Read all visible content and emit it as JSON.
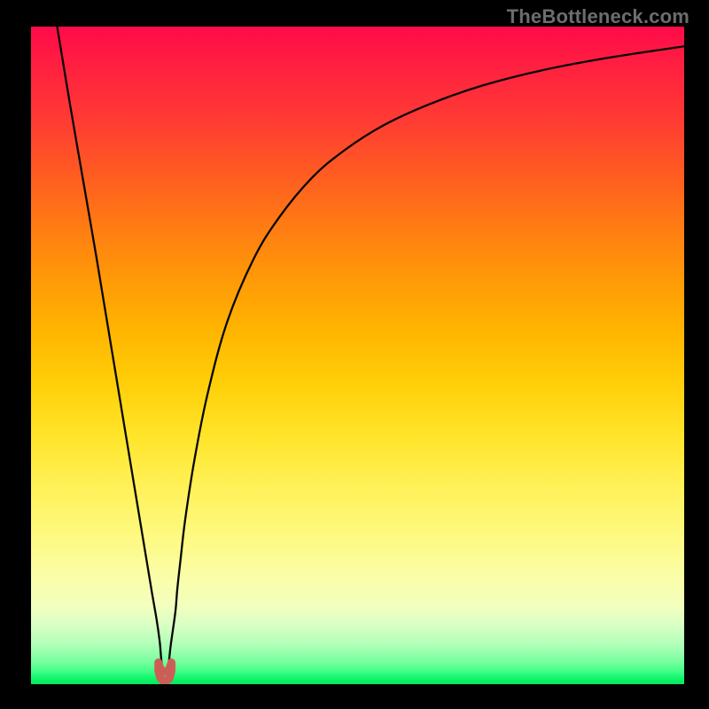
{
  "attribution": "TheBottleneck.com",
  "chart_data": {
    "type": "line",
    "title": "",
    "xlabel": "",
    "ylabel": "",
    "xlim": [
      0,
      100
    ],
    "ylim": [
      0,
      100
    ],
    "grid": false,
    "series": [
      {
        "name": "bottleneck-curve",
        "x": [
          4,
          6,
          8,
          10,
          12,
          13.5,
          15,
          16.5,
          17.5,
          18.5,
          19.2,
          19.7,
          20.0,
          20.4,
          20.9,
          21.1,
          21.4,
          22.1,
          22.4,
          22.9,
          23.6,
          25,
          27,
          30,
          34,
          38,
          43,
          48,
          54,
          61,
          69,
          78,
          88,
          100
        ],
        "y": [
          100,
          88,
          76.5,
          65,
          53,
          44,
          35,
          26,
          20,
          14,
          10,
          6.5,
          3.3,
          2.0,
          2.0,
          3.3,
          6,
          11,
          14.5,
          19,
          25,
          34,
          44,
          55,
          64.5,
          71,
          77,
          81.2,
          85,
          88.2,
          91,
          93.3,
          95.2,
          97
        ]
      },
      {
        "name": "notch-marker",
        "x": [
          19.5,
          19.5,
          19.8,
          20.2,
          20.8,
          21.2,
          21.5,
          21.5,
          21.2,
          20.8,
          20.2,
          19.8,
          19.5
        ],
        "y": [
          3.3,
          2.0,
          0.9,
          0.55,
          0.55,
          0.9,
          2.0,
          3.3,
          2.4,
          1.9,
          1.9,
          2.4,
          3.3
        ]
      }
    ],
    "styles": {
      "bottleneck-curve": {
        "stroke": "#060606",
        "width": 2.3,
        "fill": "none"
      },
      "notch-marker": {
        "stroke": "#cd5e57",
        "width": 9,
        "fill": "none",
        "linejoin": "round",
        "linecap": "round"
      }
    },
    "background_gradient": {
      "top": "#ff0a4a",
      "mid": "#ffe428",
      "bottom": "#05e85a"
    }
  }
}
